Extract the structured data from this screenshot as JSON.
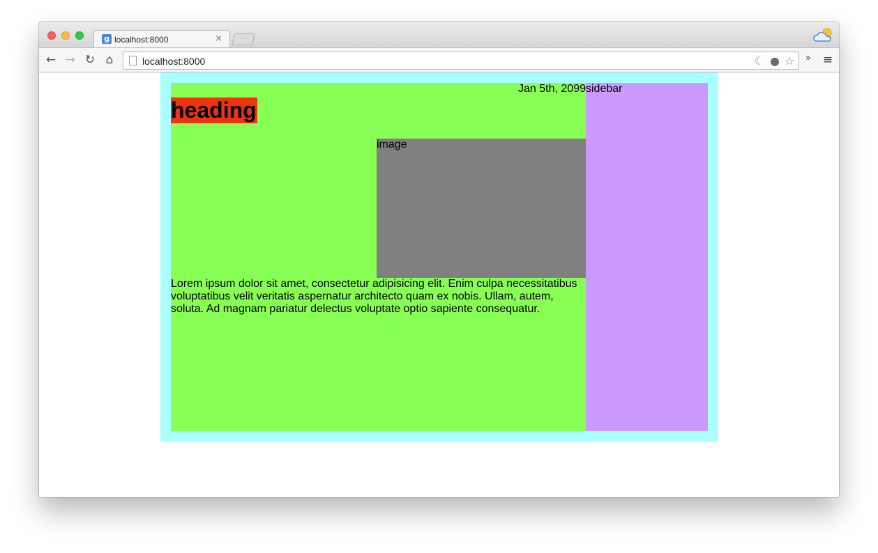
{
  "browser": {
    "tab": {
      "favicon": "g",
      "title": "localhost:8000",
      "close": "×"
    },
    "nav": {
      "back_icon": "←",
      "forward_icon": "→",
      "reload_icon": "↻",
      "home_icon": "⌂"
    },
    "omnibox": {
      "url": "localhost:8000"
    },
    "toolbar": {
      "overflow": "»",
      "menu": "≡"
    }
  },
  "page": {
    "date": "Jan 5th, 2099",
    "sidebar_label": "sidebar",
    "heading": "heading",
    "image_label": "image",
    "body_text": "Lorem ipsum dolor sit amet, consectetur adipisicing elit. Enim culpa necessitatibus voluptatibus velit veritatis aspernatur architecto quam ex nobis. Ullam, autem, soluta. Ad magnam pariatur delectus voluptate optio sapiente consequatur."
  },
  "colors": {
    "outer_frame": "#aaffff",
    "main_area": "#88ff55",
    "sidebar": "#cc99ff",
    "heading_bg": "#ee3311",
    "image_bg": "#808080"
  }
}
